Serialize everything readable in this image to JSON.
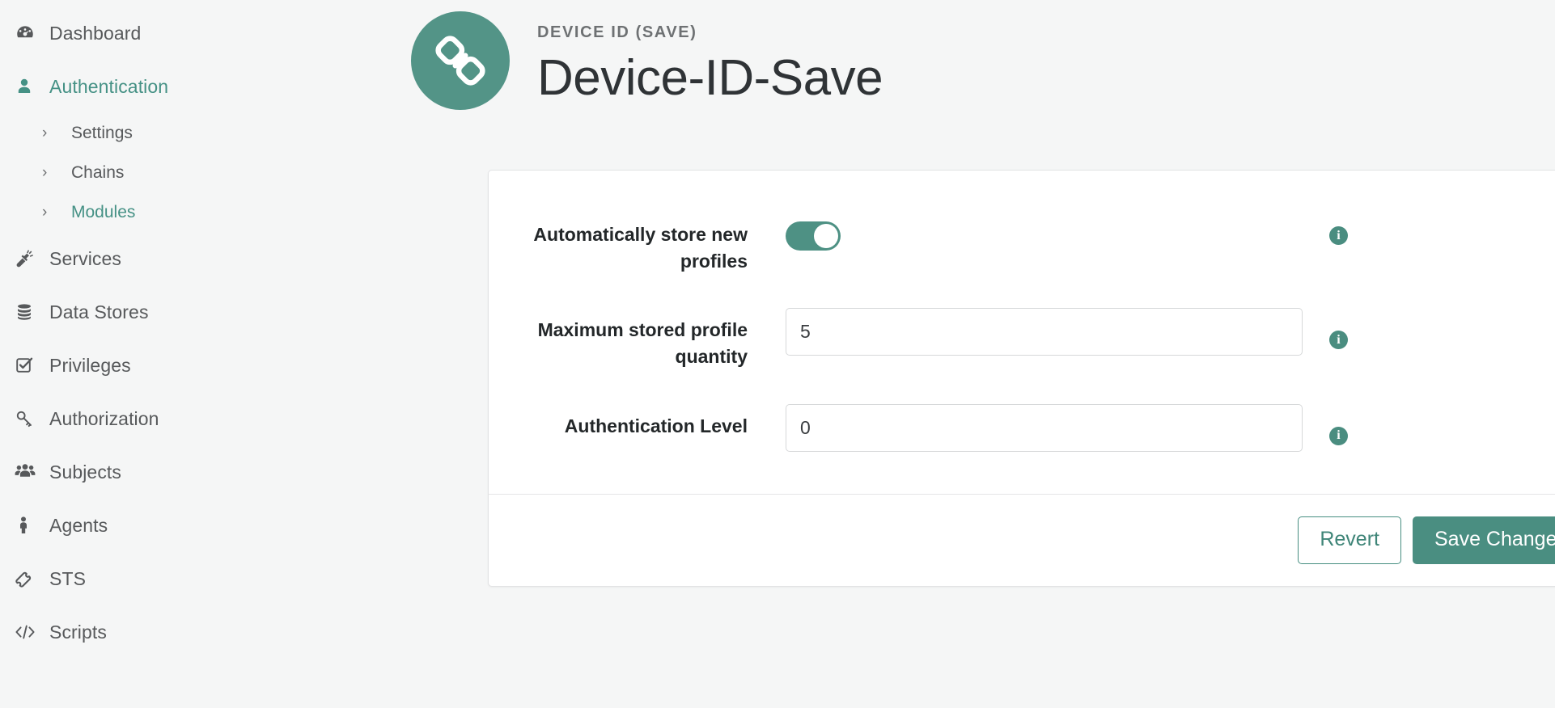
{
  "theme": {
    "accent": "#4a8e81",
    "accent_badge": "#539487",
    "page_bg": "#f5f6f6",
    "panel_bg": "#ffffff",
    "text": "#232729",
    "muted_text": "#57595b"
  },
  "sidebar": {
    "items": [
      {
        "label": "Dashboard",
        "icon": "dashboard-icon",
        "active": false
      },
      {
        "label": "Authentication",
        "icon": "user-icon",
        "active": true
      },
      {
        "label": "Services",
        "icon": "plug-icon",
        "active": false
      },
      {
        "label": "Data Stores",
        "icon": "database-icon",
        "active": false
      },
      {
        "label": "Privileges",
        "icon": "checkbox-icon",
        "active": false
      },
      {
        "label": "Authorization",
        "icon": "key-icon",
        "active": false
      },
      {
        "label": "Subjects",
        "icon": "users-icon",
        "active": false
      },
      {
        "label": "Agents",
        "icon": "person-icon",
        "active": false
      },
      {
        "label": "STS",
        "icon": "ticket-icon",
        "active": false
      },
      {
        "label": "Scripts",
        "icon": "code-icon",
        "active": false
      }
    ],
    "sub_items": [
      {
        "label": "Settings",
        "active": false
      },
      {
        "label": "Chains",
        "active": false
      },
      {
        "label": "Modules",
        "active": true
      }
    ],
    "chevron": "›"
  },
  "header": {
    "eyebrow": "DEVICE ID (SAVE)",
    "title": "Device-ID-Save",
    "badge_icon": "chain-link-icon"
  },
  "form": {
    "rows": [
      {
        "label": "Automatically store new profiles",
        "type": "toggle",
        "value": "on",
        "info": "i"
      },
      {
        "label": "Maximum stored profile quantity",
        "type": "text",
        "value": "5",
        "placeholder": "",
        "info": "i"
      },
      {
        "label": "Authentication Level",
        "type": "text",
        "value": "0",
        "placeholder": "",
        "info": "i"
      }
    ]
  },
  "footer": {
    "revert_label": "Revert",
    "save_label": "Save Changes"
  }
}
